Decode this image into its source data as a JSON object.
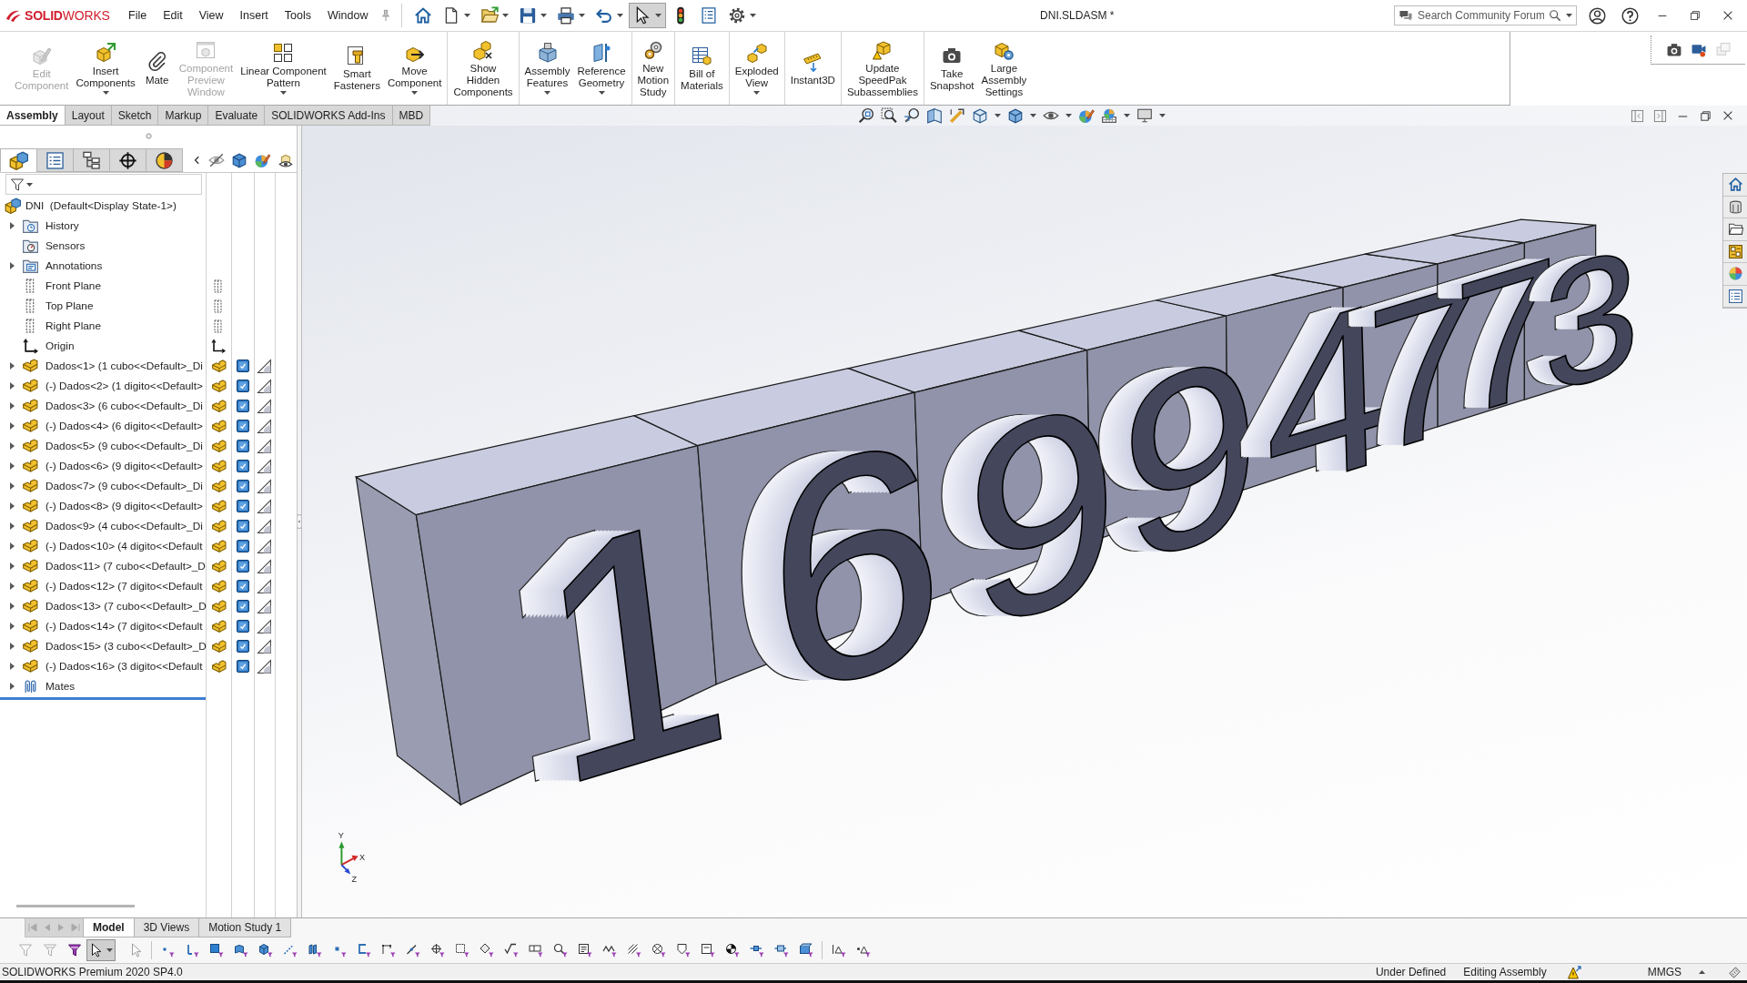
{
  "title_bar": {
    "logo": "**SOLID**WORKS",
    "menu": [
      "File",
      "Edit",
      "View",
      "Insert",
      "Tools",
      "Window"
    ],
    "document_title": "DNI.SLDASM *",
    "search": {
      "placeholder": "Search Community Forum"
    }
  },
  "quick_access": [
    {
      "has_menu": false,
      "pressed": false
    },
    {
      "has_menu": true,
      "pressed": false
    },
    {
      "has_menu": true,
      "pressed": false
    },
    {
      "has_menu": true,
      "pressed": false
    },
    {
      "has_menu": true,
      "pressed": false
    },
    {
      "has_menu": true,
      "pressed": false
    },
    {
      "has_menu": true,
      "pressed": true
    },
    {
      "has_menu": false,
      "pressed": false
    },
    {
      "has_menu": false,
      "pressed": false
    },
    {
      "has_menu": true,
      "pressed": false
    }
  ],
  "command_manager": {
    "groups": [
      [
        {
          "label": "Edit\nComponent",
          "disabled": true,
          "has_menu": false
        },
        {
          "label": "Insert\nComponents",
          "disabled": false,
          "has_menu": true
        },
        {
          "label": "Mate",
          "disabled": false,
          "has_menu": false
        },
        {
          "label": "Component\nPreview\nWindow",
          "disabled": true,
          "has_menu": false
        },
        {
          "label": "Linear Component\nPattern",
          "disabled": false,
          "has_menu": true
        },
        {
          "label": "Smart\nFasteners",
          "disabled": false,
          "has_menu": false
        },
        {
          "label": "Move\nComponent",
          "disabled": false,
          "has_menu": true
        }
      ],
      [
        {
          "label": "Show\nHidden\nComponents",
          "disabled": false,
          "has_menu": false
        }
      ],
      [
        {
          "label": "Assembly\nFeatures",
          "disabled": false,
          "has_menu": true
        },
        {
          "label": "Reference\nGeometry",
          "disabled": false,
          "has_menu": true
        }
      ],
      [
        {
          "label": "New\nMotion\nStudy",
          "disabled": false,
          "has_menu": false
        }
      ],
      [
        {
          "label": "Bill of\nMaterials",
          "disabled": false,
          "has_menu": false
        }
      ],
      [
        {
          "label": "Exploded\nView",
          "disabled": false,
          "has_menu": true
        }
      ],
      [
        {
          "label": "Instant3D",
          "disabled": false,
          "has_menu": false
        }
      ],
      [
        {
          "label": "Update\nSpeedPak\nSubassemblies",
          "disabled": false,
          "has_menu": false
        }
      ],
      [
        {
          "label": "Take\nSnapshot",
          "disabled": false,
          "has_menu": false
        },
        {
          "label": "Large\nAssembly\nSettings",
          "disabled": false,
          "has_menu": false
        }
      ]
    ]
  },
  "snapshot_tools": [
    {
      "disabled": false
    },
    {
      "disabled": false
    },
    {
      "disabled": true
    }
  ],
  "tabs": [
    {
      "label": "Assembly",
      "selected": true
    },
    {
      "label": "Layout",
      "selected": false
    },
    {
      "label": "Sketch",
      "selected": false
    },
    {
      "label": "Markup",
      "selected": false
    },
    {
      "label": "Evaluate",
      "selected": false
    },
    {
      "label": "SOLIDWORKS Add-Ins",
      "selected": false
    },
    {
      "label": "MBD",
      "selected": false
    }
  ],
  "feature_manager": {
    "panel_tabs": [
      {
        "selected": true
      },
      {
        "selected": false
      },
      {
        "selected": false
      },
      {
        "selected": false
      },
      {
        "selected": false
      }
    ],
    "tree": {
      "label": "DNI  (Default<Display State-1>)",
      "kind": "assembly",
      "children": [
        {
          "label": "History",
          "kind": "history",
          "expanded": false
        },
        {
          "label": "Sensors",
          "kind": "sensors"
        },
        {
          "label": "Annotations",
          "kind": "annotations",
          "expanded": false
        },
        {
          "label": "Front Plane",
          "kind": "plane"
        },
        {
          "label": "Top Plane",
          "kind": "plane"
        },
        {
          "label": "Right Plane",
          "kind": "plane"
        },
        {
          "label": "Origin",
          "kind": "origin"
        },
        {
          "label": "Dados<1> (1 cubo<<Default>_Di",
          "kind": "component",
          "expanded": false
        },
        {
          "label": "(-) Dados<2> (1 digito<<Default>",
          "kind": "component",
          "expanded": false
        },
        {
          "label": "Dados<3> (6 cubo<<Default>_Di",
          "kind": "component",
          "expanded": false
        },
        {
          "label": "(-) Dados<4> (6 digito<<Default>",
          "kind": "component",
          "expanded": false
        },
        {
          "label": "Dados<5> (9 cubo<<Default>_Di",
          "kind": "component",
          "expanded": false
        },
        {
          "label": "(-) Dados<6> (9 digito<<Default>",
          "kind": "component",
          "expanded": false
        },
        {
          "label": "Dados<7> (9 cubo<<Default>_Di",
          "kind": "component",
          "expanded": false
        },
        {
          "label": "(-) Dados<8> (9 digito<<Default>",
          "kind": "component",
          "expanded": false
        },
        {
          "label": "Dados<9> (4 cubo<<Default>_Di",
          "kind": "component",
          "expanded": false
        },
        {
          "label": "(-) Dados<10> (4 digito<<Default",
          "kind": "component",
          "expanded": false
        },
        {
          "label": "Dados<11> (7 cubo<<Default>_D",
          "kind": "component",
          "expanded": false
        },
        {
          "label": "(-) Dados<12> (7 digito<<Default",
          "kind": "component",
          "expanded": false
        },
        {
          "label": "Dados<13> (7 cubo<<Default>_D",
          "kind": "component",
          "expanded": false
        },
        {
          "label": "(-) Dados<14> (7 digito<<Default",
          "kind": "component",
          "expanded": false
        },
        {
          "label": "Dados<15> (3 cubo<<Default>_D",
          "kind": "component",
          "expanded": false
        },
        {
          "label": "(-) Dados<16> (3 digito<<Default",
          "kind": "component",
          "expanded": false
        },
        {
          "label": "Mates",
          "kind": "mates",
          "expanded": false
        }
      ]
    }
  },
  "model_view": {
    "digits": [
      "1",
      "6",
      "9",
      "9",
      "4",
      "7",
      "7",
      "3"
    ],
    "triad_labels": [
      "Y",
      "X",
      "Z"
    ]
  },
  "bottom_tabs": [
    {
      "label": "Model",
      "selected": true
    },
    {
      "label": "3D Views",
      "selected": false
    },
    {
      "label": "Motion Study 1",
      "selected": false
    }
  ],
  "status_bar": {
    "product": "SOLIDWORKS Premium 2020 SP4.0",
    "definition": "Under Defined",
    "mode": "Editing Assembly",
    "units": "MMGS"
  }
}
